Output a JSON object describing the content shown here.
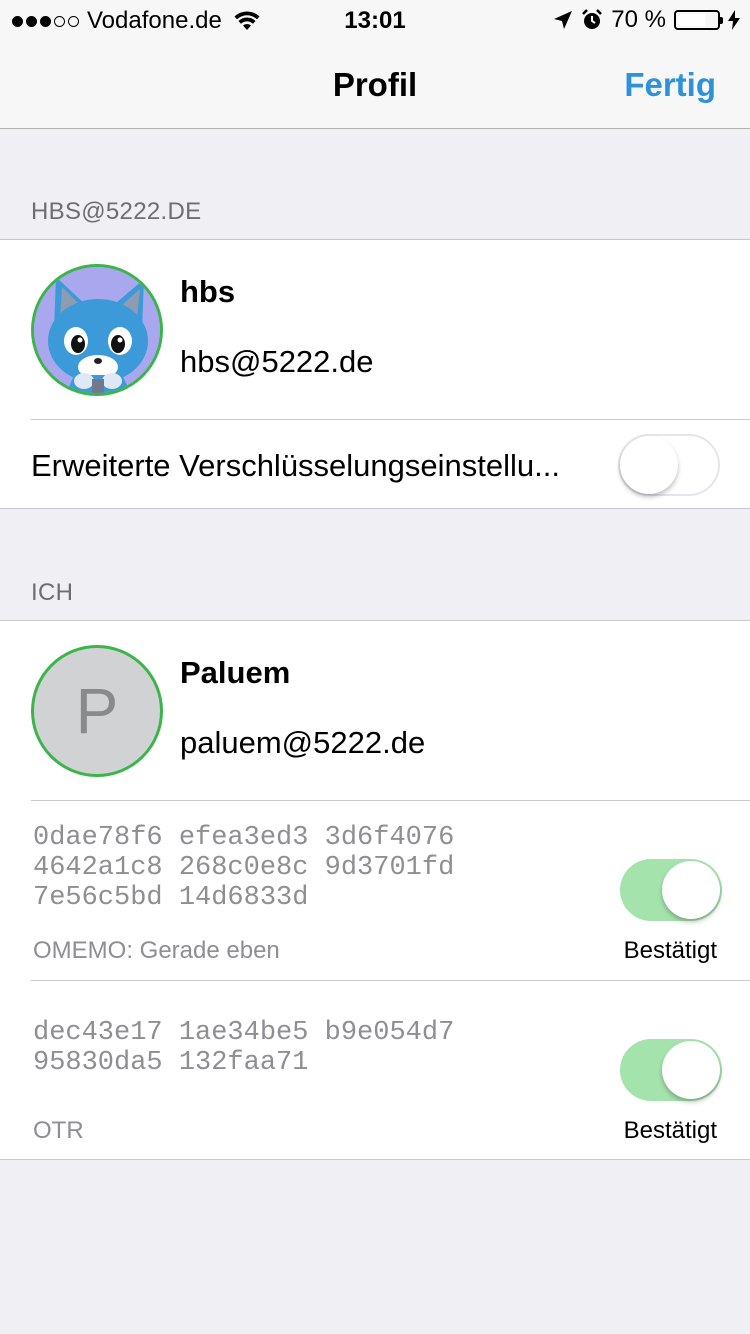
{
  "status_bar": {
    "carrier": "Vodafone.de",
    "time": "13:01",
    "battery_percent": "70 %",
    "battery_level": 0.7,
    "icons": [
      "signal-icon",
      "wifi-icon",
      "location-arrow-icon",
      "alarm-icon",
      "battery-icon",
      "charging-bolt-icon"
    ]
  },
  "nav": {
    "title": "Profil",
    "done_label": "Fertig",
    "accent_color": "#2e93d6"
  },
  "account_section": {
    "header": "HBS@5222.DE",
    "name": "hbs",
    "jid": "hbs@5222.de",
    "encryption_settings_label": "Erweiterte Verschlüsselungseinstellu...",
    "encryption_settings_enabled": false
  },
  "me_section": {
    "header": "ICH",
    "avatar_initial": "P",
    "name": "Paluem",
    "jid": "paluem@5222.de",
    "fingerprints": [
      {
        "lines": [
          "0dae78f6 efea3ed3 3d6f4076",
          "4642a1c8 268c0e8c 9d3701fd",
          "7e56c5bd 14d6833d"
        ],
        "type_label": "OMEMO: Gerade eben",
        "verified_label": "Bestätigt",
        "verified": true
      },
      {
        "lines": [
          "dec43e17 1ae34be5 b9e054d7",
          "95830da5 132faa71"
        ],
        "type_label": "OTR",
        "verified_label": "Bestätigt",
        "verified": true
      }
    ]
  },
  "colors": {
    "toggle_on": "#a5e3ad",
    "avatar_border": "#3bb54a"
  }
}
